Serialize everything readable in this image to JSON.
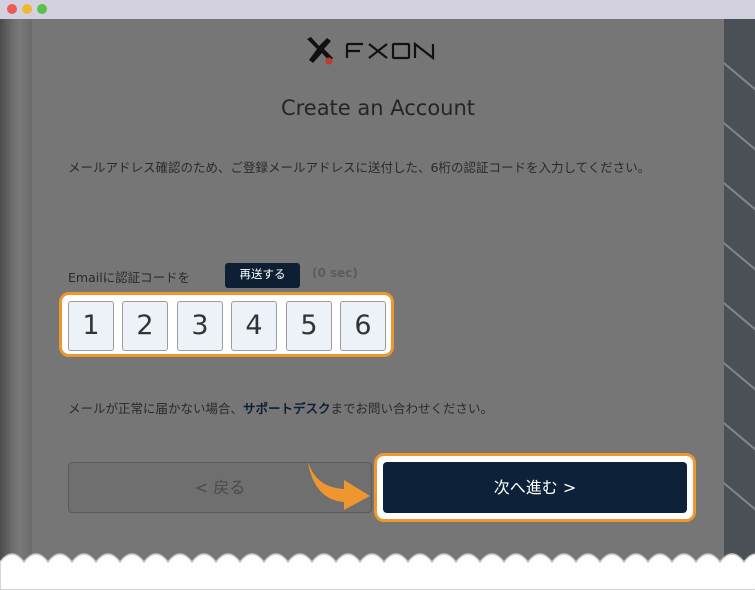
{
  "brand": {
    "name": "FXON"
  },
  "page": {
    "title": "Create an Account",
    "description": "メールアドレス確認のため、ご登録メールアドレスに送付した、6桁の認証コードを入力してください。"
  },
  "verification": {
    "label": "Emailに認証コードを",
    "resend_label": "再送する",
    "timer_text": "(0 sec)",
    "digits": [
      "1",
      "2",
      "3",
      "4",
      "5",
      "6"
    ]
  },
  "support": {
    "prefix": "メールが正常に届かない場合、",
    "link_text": "サポートデスク",
    "suffix": "までお問い合わせください。"
  },
  "actions": {
    "back_label": "< 戻る",
    "next_label": "次へ進む >"
  },
  "colors": {
    "accent_highlight": "#f0962e",
    "primary_button": "#0d2238"
  },
  "icons": {
    "logo": "fxon-logo",
    "pointer": "arrow-pointer-icon"
  }
}
